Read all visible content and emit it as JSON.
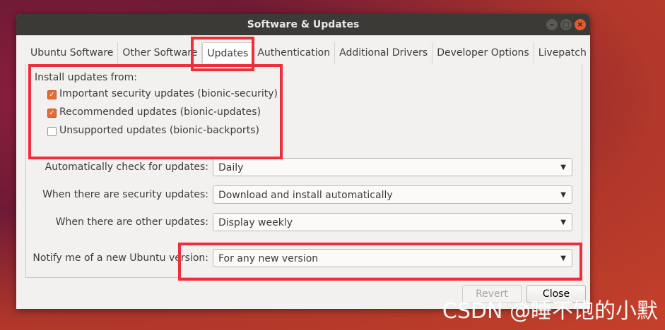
{
  "window": {
    "title": "Software & Updates",
    "controls": {
      "minimize": "–",
      "maximize": "□",
      "close": "×"
    }
  },
  "tabs": [
    {
      "label": "Ubuntu Software"
    },
    {
      "label": "Other Software"
    },
    {
      "label": "Updates"
    },
    {
      "label": "Authentication"
    },
    {
      "label": "Additional Drivers"
    },
    {
      "label": "Developer Options"
    },
    {
      "label": "Livepatch"
    }
  ],
  "updates": {
    "install_from_label": "Install updates from:",
    "sources": [
      {
        "label": "Important security updates (bionic-security)",
        "checked": true
      },
      {
        "label": "Recommended updates (bionic-updates)",
        "checked": true
      },
      {
        "label": "Unsupported updates (bionic-backports)",
        "checked": false
      }
    ],
    "auto_check": {
      "label": "Automatically check for updates:",
      "value": "Daily"
    },
    "security_updates": {
      "label": "When there are security updates:",
      "value": "Download and install automatically"
    },
    "other_updates": {
      "label": "When there are other updates:",
      "value": "Display weekly"
    },
    "notify": {
      "label": "Notify me of a new Ubuntu version:",
      "value": "For any new version"
    }
  },
  "buttons": {
    "revert": "Revert",
    "close": "Close"
  },
  "watermark": "CSDN @睡不饱的小默",
  "colors": {
    "highlight": "#ee2e3b",
    "checkbox_checked": "#e66b34",
    "titlebar": "#3b3a37"
  }
}
